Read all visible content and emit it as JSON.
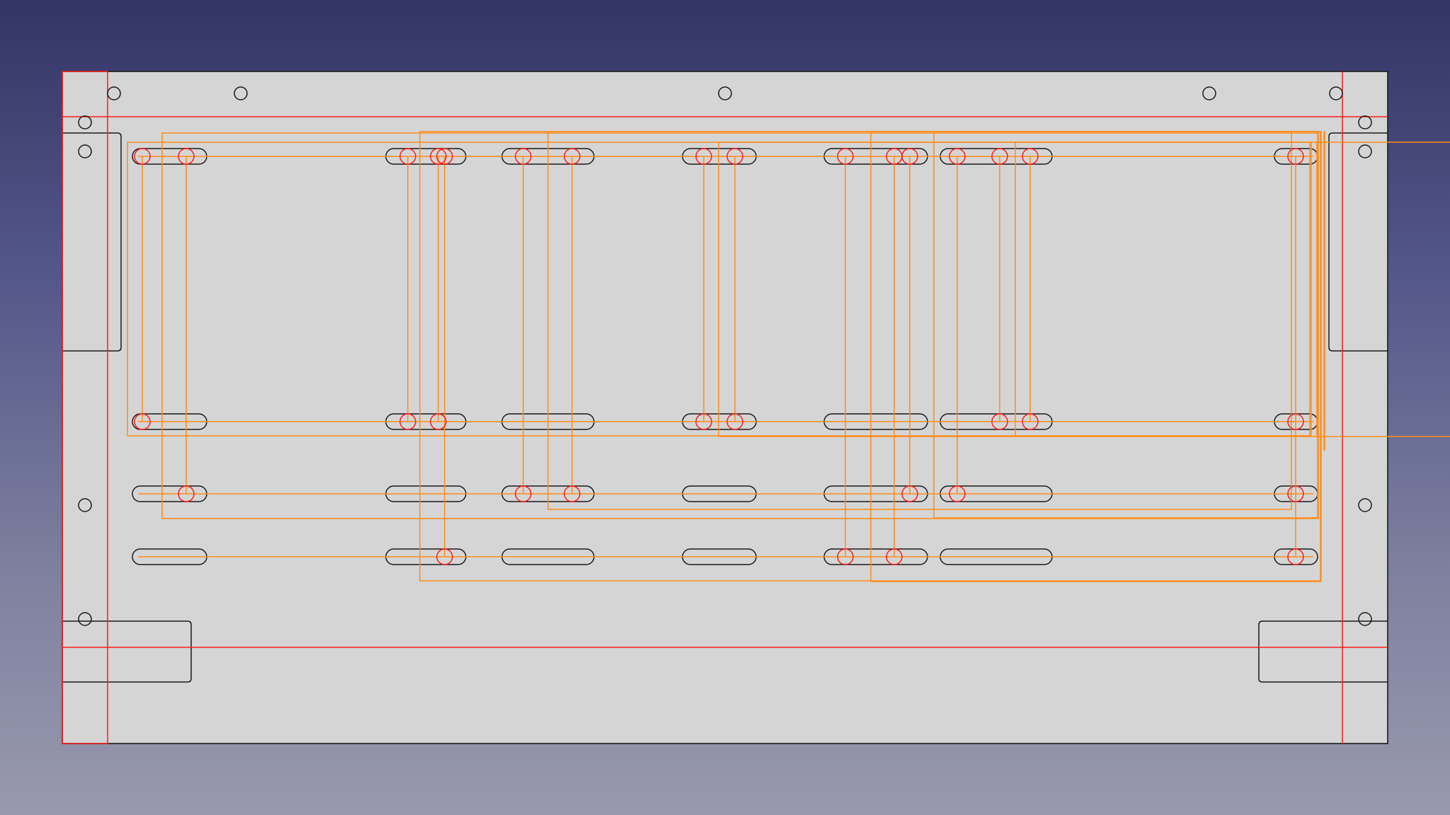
{
  "view": {
    "name": "sheet-metal-panel-drawing",
    "colors": {
      "background_top": "#333566",
      "background_bottom": "#9899ae",
      "panel_fill": "#d5d5d5",
      "outline": "#1a1a1a",
      "guide_red": "#ff1a1a",
      "construction_orange": "#ff8c1a",
      "hole_red": "#ff1a1a"
    }
  }
}
